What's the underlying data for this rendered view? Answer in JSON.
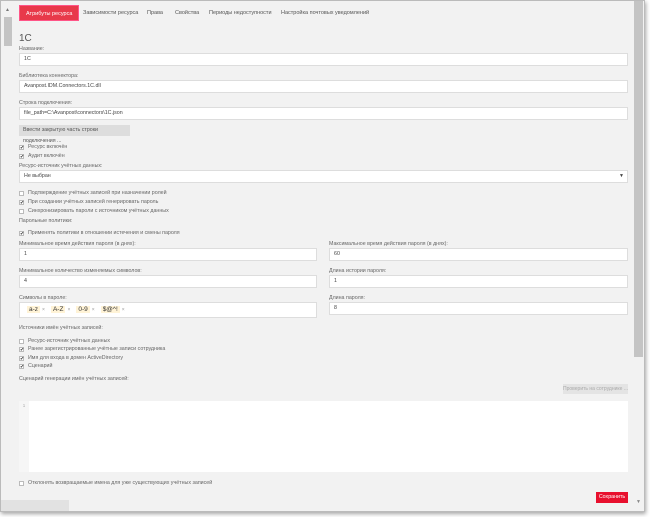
{
  "tabs": [
    "Атрибуты ресурса",
    "Зависимости ресурса",
    "Права",
    "Свойства",
    "Периоды недоступности",
    "Настройка почтовых уведомлений"
  ],
  "title": "1С",
  "name": {
    "label": "Название:",
    "value": "1С"
  },
  "library": {
    "label": "Библиотека коннектора:",
    "value": "Avanpost.IDM.Connectors.1C.dll"
  },
  "conn": {
    "label": "Строка подключения:",
    "value": "file_path=C:\\Avanpost\\connectors\\1C.json",
    "button": "Ввести закрытую часть строки подключения ..."
  },
  "checks1": [
    {
      "label": "Ресурс включён",
      "checked": true
    },
    {
      "label": "Аудит включён",
      "checked": true
    }
  ],
  "source": {
    "label": "Ресурс-источник учётных данных:",
    "value": "Не выбран"
  },
  "checks2": [
    {
      "label": "Подтверждение учётных записей при назначении ролей",
      "checked": false
    },
    {
      "label": "При создании учётных записей генерировать пароль",
      "checked": true
    },
    {
      "label": "Синхронизировать пароли с источником учётных данных",
      "checked": false
    }
  ],
  "policies": {
    "label": "Парольные политики:",
    "apply": "Применять политики в отношении истечения и смены пароля",
    "apply_checked": true
  },
  "min_days": {
    "label": "Минимальное время действия пароля (в днях):",
    "value": "1"
  },
  "max_days": {
    "label": "Максимальное время действия пароля (в днях):",
    "value": "60"
  },
  "min_changed": {
    "label": "Минимальное количество изменяемых символов:",
    "value": "4"
  },
  "history": {
    "label": "Длина истории пароля:",
    "value": "1"
  },
  "symbols": {
    "label": "Символы в пароле:",
    "tags": [
      "a-z",
      "A-Z",
      "0-9",
      "$@^!"
    ]
  },
  "length": {
    "label": "Длина пароля:",
    "value": "8"
  },
  "name_sources": {
    "label": "Источники имён учётных записей:",
    "items": [
      {
        "label": "Ресурс-источник учётных данных",
        "checked": false
      },
      {
        "label": "Ранее зарегистрированные учётные записи сотрудника",
        "checked": true
      },
      {
        "label": "Имя для входа в домен ActiveDirectory",
        "checked": true
      },
      {
        "label": "Сценарий",
        "checked": true
      }
    ]
  },
  "script": {
    "label": "Сценарий генерации имён учётных записей:",
    "check_button": "Проверить на сотруднике ...",
    "line": "1"
  },
  "reject": {
    "label": "Отклонять возвращаемые имена для уже существующих учётных записей",
    "checked": false
  },
  "save": "Сохранить",
  "colors": {
    "accent": "#e8394a",
    "save": "#e8102e"
  }
}
